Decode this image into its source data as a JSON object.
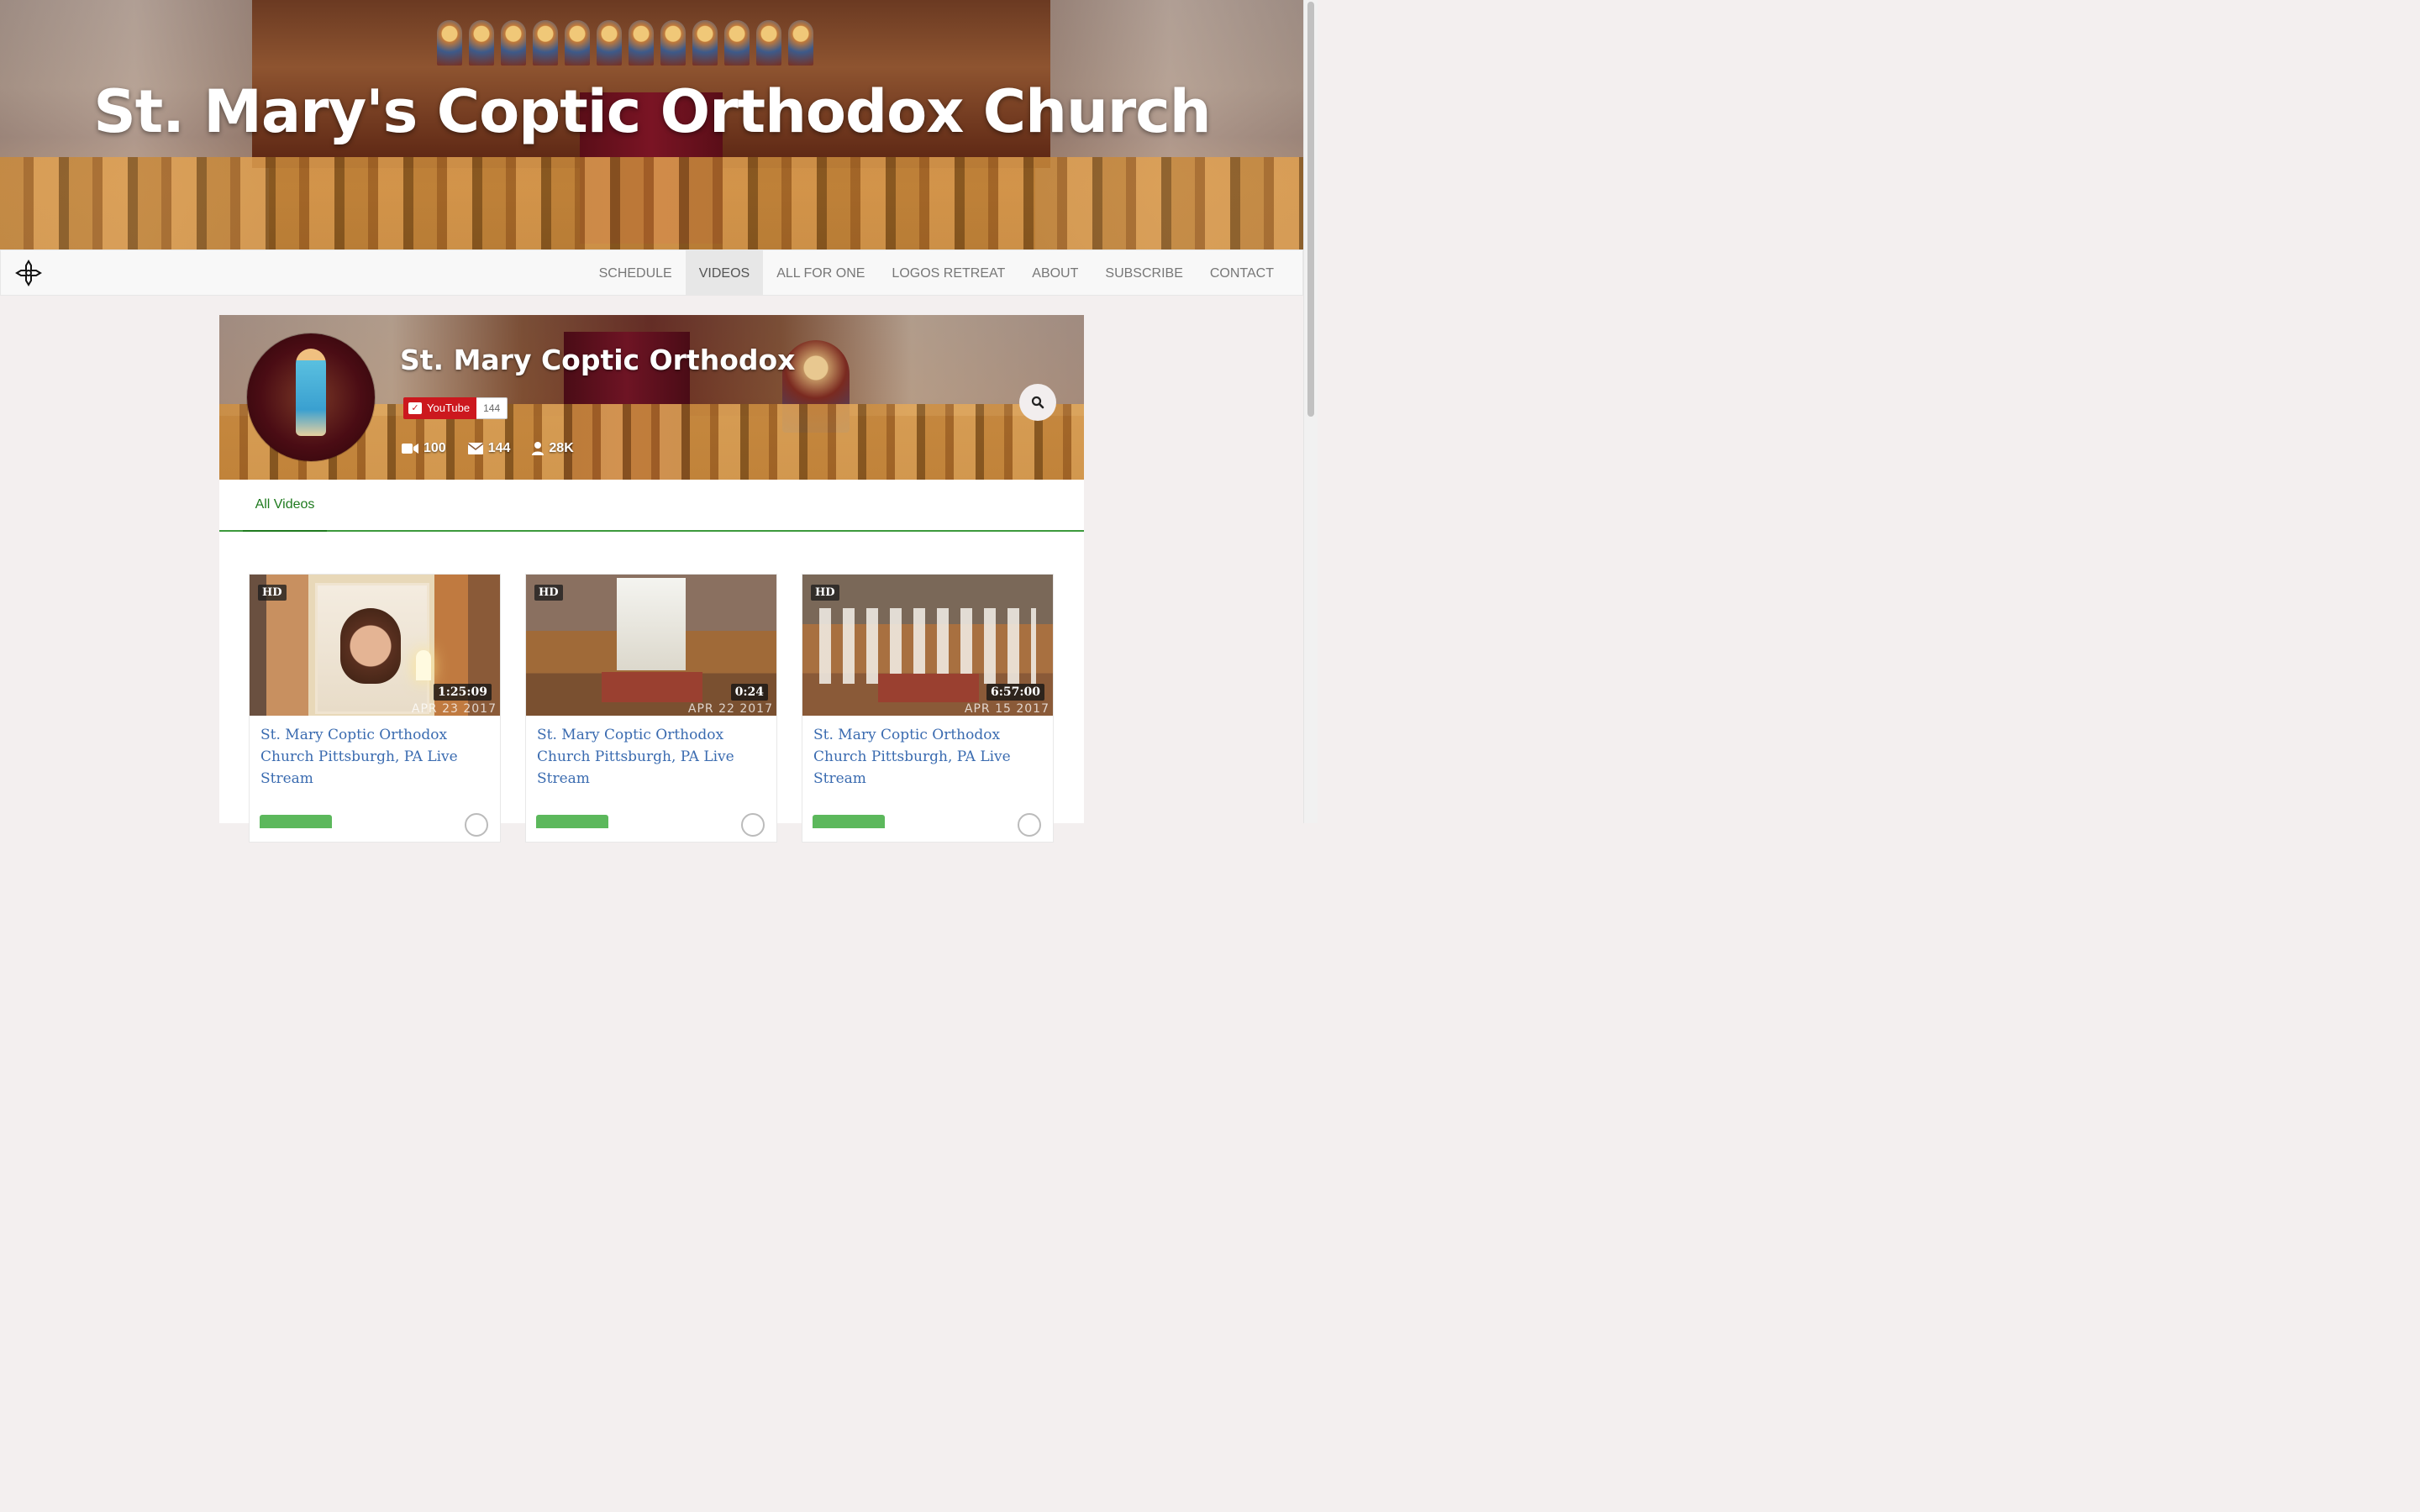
{
  "site": {
    "title": "St. Mary's Coptic Orthodox Church"
  },
  "nav": {
    "items": [
      {
        "label": "SCHEDULE"
      },
      {
        "label": "VIDEOS",
        "active": true
      },
      {
        "label": "ALL FOR ONE"
      },
      {
        "label": "LOGOS RETREAT"
      },
      {
        "label": "ABOUT"
      },
      {
        "label": "SUBSCRIBE"
      },
      {
        "label": "CONTACT"
      }
    ]
  },
  "channel": {
    "name": "St. Mary Coptic Orthodox",
    "subscribe": {
      "label": "YouTube",
      "count": "144"
    },
    "stats": {
      "videos": "100",
      "subscribers": "144",
      "views": "28K"
    }
  },
  "tabs": {
    "active": "All Videos"
  },
  "videos": [
    {
      "badge": "HD",
      "duration": "1:25:09",
      "date": "APR 23 2017",
      "title": "St. Mary Coptic Orthodox Church Pittsburgh, PA Live Stream"
    },
    {
      "badge": "HD",
      "duration": "0:24",
      "date": "APR 22 2017",
      "title": "St. Mary Coptic Orthodox Church Pittsburgh, PA Live Stream"
    },
    {
      "badge": "HD",
      "duration": "6:57:00",
      "date": "APR 15 2017",
      "title": "St. Mary Coptic Orthodox Church Pittsburgh, PA Live Stream"
    }
  ],
  "colors": {
    "accent_green": "#1e7a1e",
    "youtube_red": "#cc181e",
    "link_blue": "#3a6bb0"
  },
  "icons": {
    "logo": "coptic-cross-icon",
    "search": "search-icon",
    "videos": "video-camera-icon",
    "subscribers": "envelope-icon",
    "views": "user-icon"
  }
}
